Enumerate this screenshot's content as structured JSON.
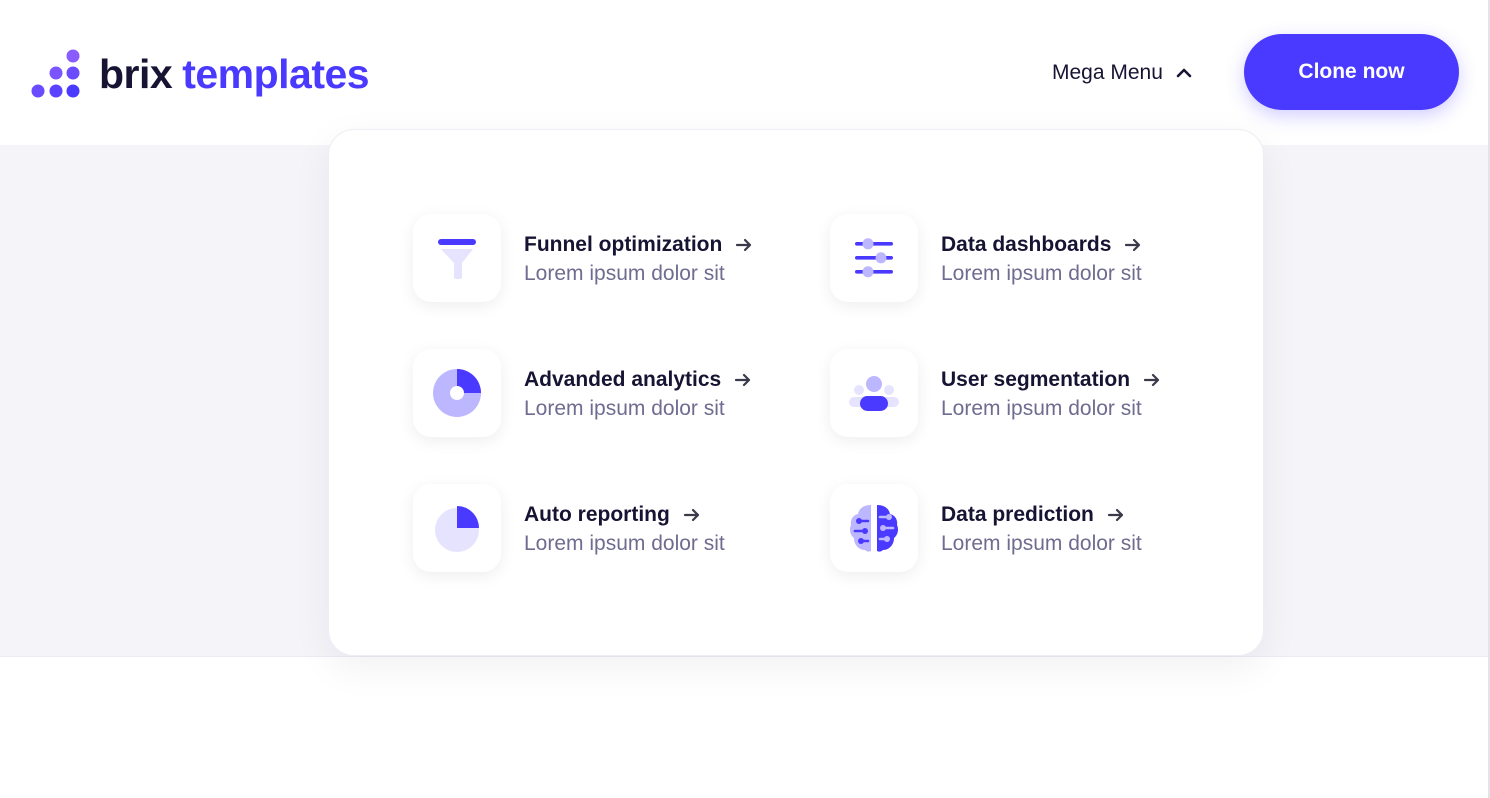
{
  "brand": {
    "word1": "brix",
    "word2": "templates",
    "mark_icon": "dots-logo-icon"
  },
  "nav": {
    "mega_menu_label": "Mega Menu",
    "mega_menu_icon": "chevron-up-icon",
    "cta_label": "Clone now"
  },
  "colors": {
    "accent": "#4a3aff",
    "accent_light": "#bdb7ff",
    "accent_pale": "#e6e3ff",
    "heading": "#171433",
    "body_text": "#6f6c90",
    "band_background": "#f4f4f9"
  },
  "menu": {
    "items": [
      {
        "title": "Funnel optimization",
        "description": "Lorem ipsum dolor sit",
        "icon": "funnel-icon"
      },
      {
        "title": "Data dashboards",
        "description": "Lorem ipsum dolor sit",
        "icon": "sliders-icon"
      },
      {
        "title": "Advanded analytics",
        "description": "Lorem ipsum dolor sit",
        "icon": "donut-chart-icon"
      },
      {
        "title": "User segmentation",
        "description": "Lorem ipsum dolor sit",
        "icon": "user-group-icon"
      },
      {
        "title": "Auto reporting",
        "description": "Lorem ipsum dolor sit",
        "icon": "pie-chart-icon"
      },
      {
        "title": "Data prediction",
        "description": "Lorem ipsum dolor sit",
        "icon": "brain-icon"
      }
    ]
  }
}
